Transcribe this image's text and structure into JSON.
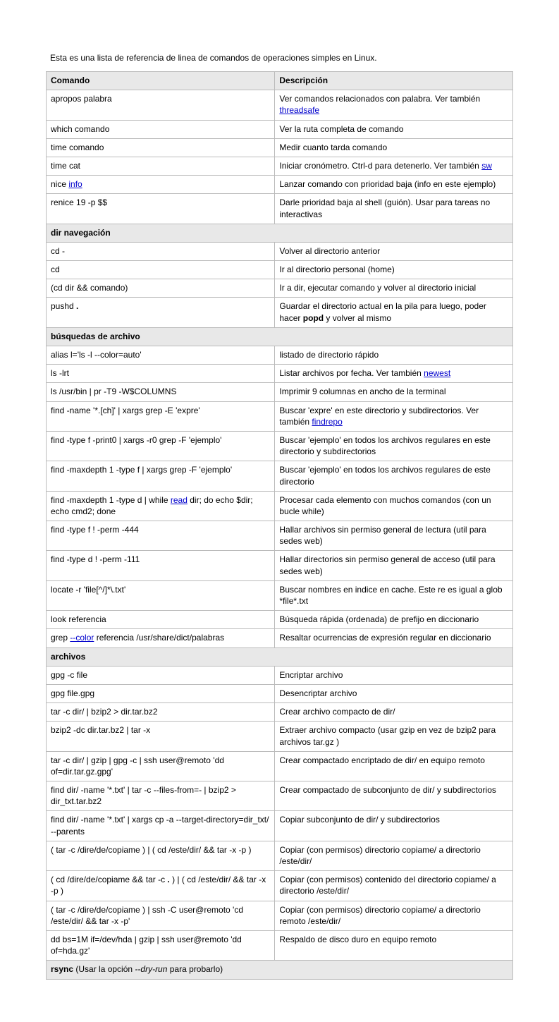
{
  "intro": "Esta es una lista de referencia de linea de comandos de operaciones simples en Linux.",
  "headers": {
    "command": "Comando",
    "description": "Descripción"
  },
  "rows": [
    {
      "type": "data",
      "cmd": [
        {
          "t": "apropos palabra"
        }
      ],
      "desc": [
        {
          "t": "Ver comandos relacionados con palabra. Ver también "
        },
        {
          "t": "threadsafe",
          "link": true
        }
      ]
    },
    {
      "type": "data",
      "cmd": [
        {
          "t": "which comando"
        }
      ],
      "desc": [
        {
          "t": "Ver la ruta completa de comando"
        }
      ]
    },
    {
      "type": "data",
      "cmd": [
        {
          "t": "time comando"
        }
      ],
      "desc": [
        {
          "t": "Medir cuanto tarda comando"
        }
      ]
    },
    {
      "type": "data",
      "cmd": [
        {
          "t": "time cat"
        }
      ],
      "desc": [
        {
          "t": "Iniciar cronómetro. Ctrl-d para detenerlo. Ver también "
        },
        {
          "t": "sw",
          "link": true
        }
      ]
    },
    {
      "type": "data",
      "cmd": [
        {
          "t": "nice "
        },
        {
          "t": "info",
          "link": true
        }
      ],
      "desc": [
        {
          "t": "Lanzar comando con prioridad baja (info en este ejemplo)"
        }
      ]
    },
    {
      "type": "data",
      "cmd": [
        {
          "t": "renice 19 -p $$"
        }
      ],
      "desc": [
        {
          "t": "Darle prioridad baja al shell (guión). Usar para tareas no interactivas"
        }
      ]
    },
    {
      "type": "section",
      "label": "dir navegación"
    },
    {
      "type": "data",
      "cmd": [
        {
          "t": "cd -"
        }
      ],
      "desc": [
        {
          "t": "Volver al directorio anterior"
        }
      ]
    },
    {
      "type": "data",
      "cmd": [
        {
          "t": "cd"
        }
      ],
      "desc": [
        {
          "t": "Ir al directorio personal (home)"
        }
      ]
    },
    {
      "type": "data",
      "cmd": [
        {
          "t": "(cd dir && comando)"
        }
      ],
      "desc": [
        {
          "t": "Ir a dir, ejecutar comando y volver al directorio inicial"
        }
      ]
    },
    {
      "type": "data",
      "cmd": [
        {
          "t": "pushd "
        },
        {
          "t": ".",
          "bold": true
        }
      ],
      "desc": [
        {
          "t": "Guardar el directorio actual en la pila para luego, poder hacer "
        },
        {
          "t": "popd",
          "bold": true
        },
        {
          "t": " y volver al mismo"
        }
      ]
    },
    {
      "type": "section",
      "label": "búsquedas de archivo"
    },
    {
      "type": "data",
      "cmd": [
        {
          "t": "alias l='ls -l --color=auto'"
        }
      ],
      "desc": [
        {
          "t": "listado de directorio rápido"
        }
      ]
    },
    {
      "type": "data",
      "cmd": [
        {
          "t": "ls -lrt"
        }
      ],
      "desc": [
        {
          "t": "Listar archivos por fecha. Ver también "
        },
        {
          "t": "newest",
          "link": true
        }
      ]
    },
    {
      "type": "data",
      "cmd": [
        {
          "t": "ls /usr/bin | pr -T9 -W$COLUMNS"
        }
      ],
      "desc": [
        {
          "t": "Imprimir 9 columnas en ancho de la terminal"
        }
      ]
    },
    {
      "type": "data",
      "cmd": [
        {
          "t": "find -name '*.[ch]' | xargs grep -E 'expre'"
        }
      ],
      "desc": [
        {
          "t": "Buscar 'expre' en este directorio y subdirectorios. Ver también "
        },
        {
          "t": "findrepo",
          "link": true
        }
      ]
    },
    {
      "type": "data",
      "cmd": [
        {
          "t": "find -type f -print0 | xargs -r0 grep -F 'ejemplo'"
        }
      ],
      "desc": [
        {
          "t": "Buscar 'ejemplo' en todos los archivos regulares en este directorio y subdirectorios"
        }
      ]
    },
    {
      "type": "data",
      "cmd": [
        {
          "t": "find -maxdepth 1 -type f | xargs grep -F 'ejemplo'"
        }
      ],
      "desc": [
        {
          "t": "Buscar 'ejemplo' en todos los archivos regulares de este directorio"
        }
      ]
    },
    {
      "type": "data",
      "cmd": [
        {
          "t": "find -maxdepth 1 -type d | while "
        },
        {
          "t": "read",
          "link": true
        },
        {
          "t": " dir; do echo $dir; echo cmd2; done"
        }
      ],
      "desc": [
        {
          "t": "Procesar cada elemento con muchos comandos (con un bucle while)"
        }
      ]
    },
    {
      "type": "data",
      "cmd": [
        {
          "t": "find -type f ! -perm -444"
        }
      ],
      "desc": [
        {
          "t": "Hallar archivos sin permiso general de lectura (util para sedes web)"
        }
      ]
    },
    {
      "type": "data",
      "cmd": [
        {
          "t": "find -type d ! -perm -111"
        }
      ],
      "desc": [
        {
          "t": "Hallar directorios sin permiso general de acceso (util para sedes web)"
        }
      ]
    },
    {
      "type": "data",
      "cmd": [
        {
          "t": "locate -r 'file[^/]*\\.txt'"
        }
      ],
      "desc": [
        {
          "t": "Buscar nombres en indice en cache. Este re es igual a glob *file*.txt"
        }
      ]
    },
    {
      "type": "data",
      "cmd": [
        {
          "t": "look referencia"
        }
      ],
      "desc": [
        {
          "t": "Búsqueda rápida (ordenada) de prefijo en diccionario"
        }
      ]
    },
    {
      "type": "data",
      "cmd": [
        {
          "t": "grep "
        },
        {
          "t": "--color",
          "link": true
        },
        {
          "t": " referencia /usr/share/dict/palabras"
        }
      ],
      "desc": [
        {
          "t": "Resaltar ocurrencias de expresión regular en diccionario"
        }
      ]
    },
    {
      "type": "section",
      "label": "archivos"
    },
    {
      "type": "data",
      "cmd": [
        {
          "t": "gpg -c file"
        }
      ],
      "desc": [
        {
          "t": "Encriptar archivo"
        }
      ]
    },
    {
      "type": "data",
      "cmd": [
        {
          "t": "gpg file.gpg"
        }
      ],
      "desc": [
        {
          "t": "Desencriptar archivo"
        }
      ]
    },
    {
      "type": "data",
      "cmd": [
        {
          "t": "tar -c dir/ | bzip2 > dir.tar.bz2"
        }
      ],
      "desc": [
        {
          "t": "Crear archivo compacto de dir/"
        }
      ]
    },
    {
      "type": "data",
      "cmd": [
        {
          "t": "bzip2 -dc dir.tar.bz2 | tar -x"
        }
      ],
      "desc": [
        {
          "t": "Extraer archivo compacto (usar gzip en vez de bzip2 para archivos tar.gz )"
        }
      ]
    },
    {
      "type": "data",
      "cmd": [
        {
          "t": "tar -c dir/ | gzip | gpg -c | ssh user@remoto 'dd of=dir.tar.gz.gpg'"
        }
      ],
      "desc": [
        {
          "t": "Crear compactado encriptado de dir/ en equipo remoto"
        }
      ]
    },
    {
      "type": "data",
      "cmd": [
        {
          "t": "find dir/ -name '*.txt' | tar -c --files-from=- | bzip2 > dir_txt.tar.bz2"
        }
      ],
      "desc": [
        {
          "t": "Crear compactado de subconjunto de dir/ y subdirectorios"
        }
      ]
    },
    {
      "type": "data",
      "cmd": [
        {
          "t": "find dir/ -name '*.txt' | xargs cp -a --target-directory=dir_txt/ --parents"
        }
      ],
      "desc": [
        {
          "t": "Copiar subconjunto de dir/ y subdirectorios"
        }
      ]
    },
    {
      "type": "data",
      "cmd": [
        {
          "t": "( tar -c /dire/de/copiame ) | ( cd /este/dir/ && tar -x -p )"
        }
      ],
      "desc": [
        {
          "t": "Copiar (con permisos) directorio copiame/ a directorio /este/dir/"
        }
      ]
    },
    {
      "type": "data",
      "cmd": [
        {
          "t": "( cd /dire/de/copiame && tar -c "
        },
        {
          "t": ".",
          "bold": true
        },
        {
          "t": " ) | ( cd /este/dir/ && tar -x -p )"
        }
      ],
      "desc": [
        {
          "t": "Copiar (con permisos) contenido del directorio copiame/ a directorio /este/dir/"
        }
      ]
    },
    {
      "type": "data",
      "cmd": [
        {
          "t": "( tar -c /dire/de/copiame ) | ssh -C user@remoto 'cd /este/dir/ && tar -x -p'"
        }
      ],
      "desc": [
        {
          "t": "Copiar (con permisos) directorio copiame/ a directorio remoto /este/dir/"
        }
      ]
    },
    {
      "type": "data",
      "cmd": [
        {
          "t": "dd bs=1M if=/dev/hda | gzip | ssh user@remoto 'dd of=hda.gz'"
        }
      ],
      "desc": [
        {
          "t": "Respaldo de disco duro en equipo remoto"
        }
      ]
    },
    {
      "type": "section",
      "label_parts": [
        {
          "t": "rsync",
          "bold": true
        },
        {
          "t": " (Usar la opción "
        },
        {
          "t": "--dry-run",
          "italic": true
        },
        {
          "t": " para probarlo)"
        }
      ]
    }
  ]
}
